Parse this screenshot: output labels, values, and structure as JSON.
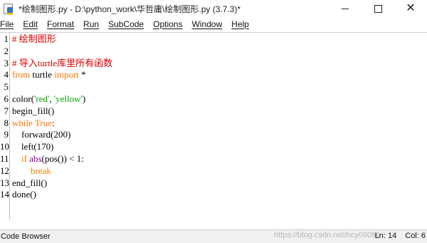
{
  "window": {
    "title": "*绘制图形.py - D:\\python_work\\华哲庸\\绘制图形.py (3.7.3)*",
    "controls": {
      "minimize": "—",
      "maximize": "☐",
      "close": "✕"
    }
  },
  "menu": {
    "items": [
      "File",
      "Edit",
      "Format",
      "Run",
      "SubCode",
      "Options",
      "Window",
      "Help"
    ]
  },
  "editor": {
    "line_numbers": [
      "1",
      "2",
      "3",
      "4",
      "5",
      "6",
      "7",
      "8",
      "9",
      "10",
      "11",
      "12",
      "13",
      "14"
    ],
    "lines": [
      [
        {
          "t": "# 绘制图形",
          "c": "comment"
        }
      ],
      [],
      [
        {
          "t": "# 导入turtle库里所有函数",
          "c": "comment"
        }
      ],
      [
        {
          "t": "from",
          "c": "keyword"
        },
        {
          "t": " turtle ",
          "c": "plain"
        },
        {
          "t": "import",
          "c": "keyword"
        },
        {
          "t": " *",
          "c": "plain"
        }
      ],
      [],
      [
        {
          "t": "color(",
          "c": "plain"
        },
        {
          "t": "'red'",
          "c": "string"
        },
        {
          "t": ", ",
          "c": "plain"
        },
        {
          "t": "'yellow'",
          "c": "string"
        },
        {
          "t": ")",
          "c": "plain"
        }
      ],
      [
        {
          "t": "begin_fill()",
          "c": "plain"
        }
      ],
      [
        {
          "t": "while",
          "c": "keyword"
        },
        {
          "t": " ",
          "c": "plain"
        },
        {
          "t": "True",
          "c": "keyword"
        },
        {
          "t": ":",
          "c": "plain"
        }
      ],
      [
        {
          "t": "    forward(200)",
          "c": "plain"
        }
      ],
      [
        {
          "t": "    left(170)",
          "c": "plain"
        }
      ],
      [
        {
          "t": "    ",
          "c": "plain"
        },
        {
          "t": "if",
          "c": "keyword"
        },
        {
          "t": " ",
          "c": "plain"
        },
        {
          "t": "abs",
          "c": "builtin"
        },
        {
          "t": "(pos()) < 1:",
          "c": "plain"
        }
      ],
      [
        {
          "t": "        ",
          "c": "plain"
        },
        {
          "t": "break",
          "c": "keyword"
        }
      ],
      [
        {
          "t": "end_fill()",
          "c": "plain"
        }
      ],
      [
        {
          "t": "done()",
          "c": "plain"
        }
      ]
    ]
  },
  "statusbar": {
    "left": "Code Browser",
    "watermark": "https://blog.csdn.net/hcy09066",
    "line": "Ln: 14",
    "col": "Col: 6"
  }
}
